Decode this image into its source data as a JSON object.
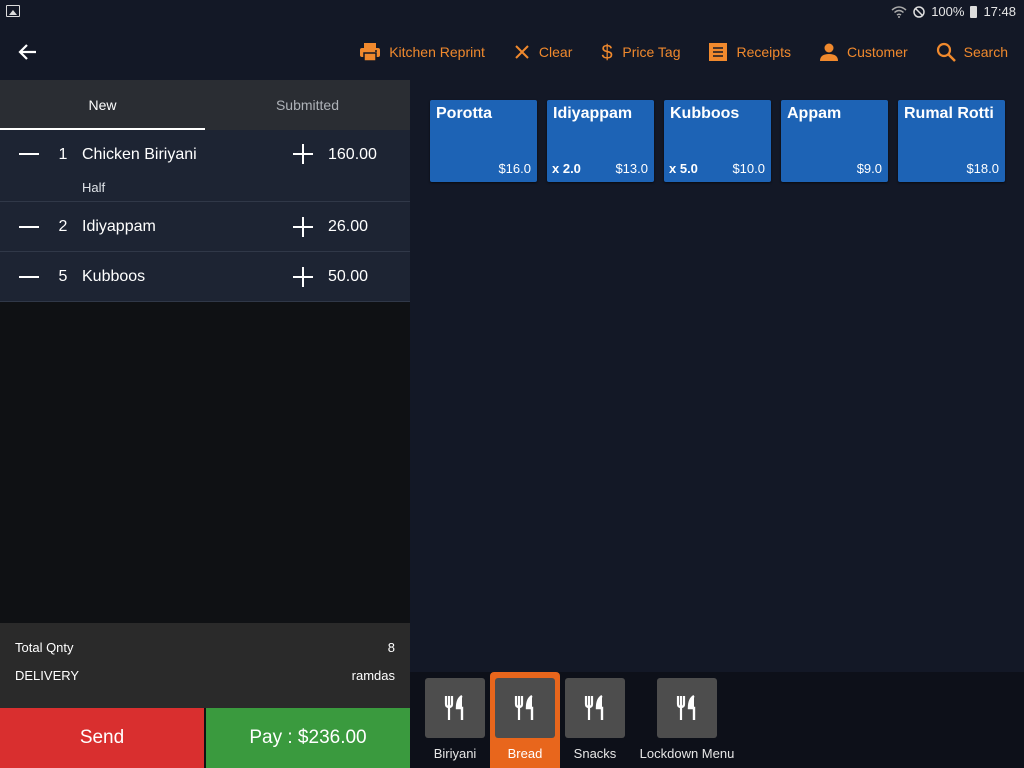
{
  "status_bar": {
    "battery": "100%",
    "time": "17:48"
  },
  "toolbar": {
    "items": [
      {
        "label": "Kitchen Reprint",
        "icon": "printer-icon"
      },
      {
        "label": "Clear",
        "icon": "close-icon"
      },
      {
        "label": "Price Tag",
        "icon": "dollar-icon"
      },
      {
        "label": "Receipts",
        "icon": "receipt-icon"
      },
      {
        "label": "Customer",
        "icon": "person-icon"
      },
      {
        "label": "Search",
        "icon": "search-icon"
      }
    ],
    "accent_color": "#f0892d"
  },
  "order_tabs": {
    "new": "New",
    "submitted": "Submitted"
  },
  "order_items": [
    {
      "qty": "1",
      "name": "Chicken Biriyani",
      "note": "Half",
      "price": "160.00"
    },
    {
      "qty": "2",
      "name": "Idiyappam",
      "note": "",
      "price": "26.00"
    },
    {
      "qty": "5",
      "name": "Kubboos",
      "note": "",
      "price": "50.00"
    }
  ],
  "totals": {
    "total_qty_label": "Total Qnty",
    "total_qty_value": "8",
    "order_type": "DELIVERY",
    "customer": "ramdas"
  },
  "actions": {
    "send": "Send",
    "pay": "Pay : $236.00",
    "send_color": "#d92f2f",
    "pay_color": "#3a9a3e"
  },
  "menu_items": [
    {
      "name": "Porotta",
      "qty": "",
      "price": "$16.0"
    },
    {
      "name": "Idiyappam",
      "qty": "x 2.0",
      "price": "$13.0"
    },
    {
      "name": "Kubboos",
      "qty": "x 5.0",
      "price": "$10.0"
    },
    {
      "name": "Appam",
      "qty": "",
      "price": "$9.0"
    },
    {
      "name": "Rumal Rotti",
      "qty": "",
      "price": "$18.0"
    }
  ],
  "categories": [
    {
      "label": "Biriyani",
      "icon": "fork-knife-icon",
      "active": false
    },
    {
      "label": "Bread",
      "icon": "fork-knife-icon",
      "active": true
    },
    {
      "label": "Snacks",
      "icon": "fork-knife-icon",
      "active": false
    },
    {
      "label": "Lockdown Menu",
      "icon": "fork-knife-icon",
      "active": false
    }
  ]
}
